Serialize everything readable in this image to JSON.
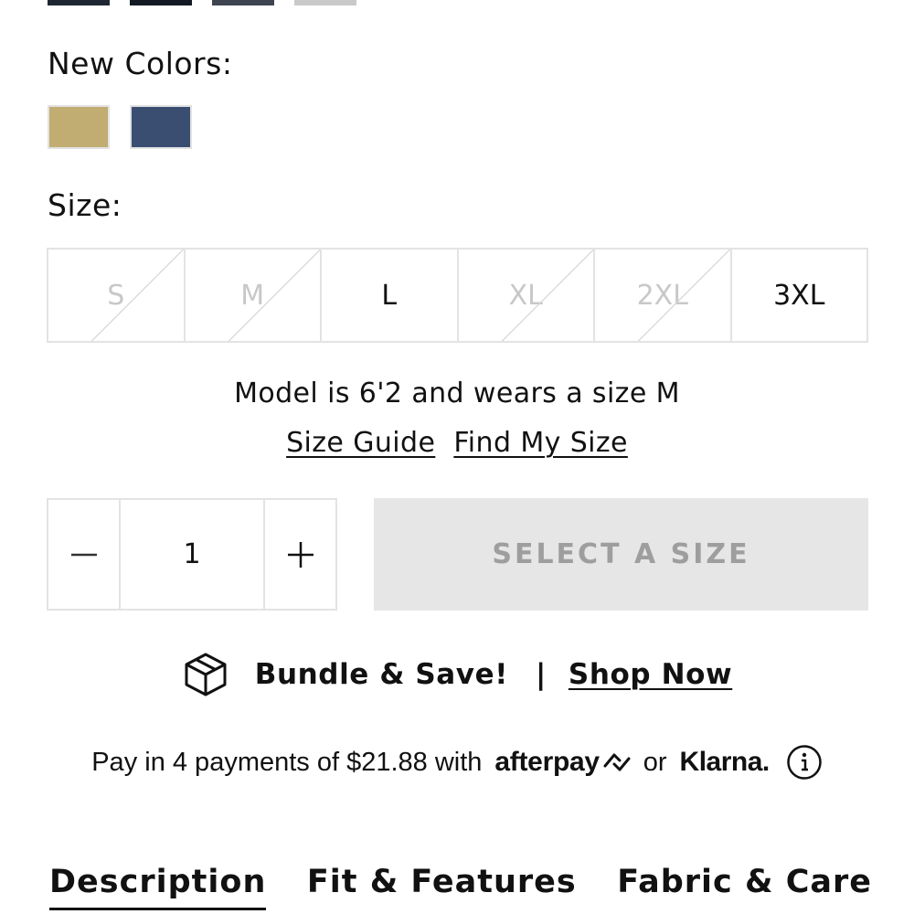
{
  "top_swatches": [
    {
      "name": "swatch-1",
      "color": "#1f2633"
    },
    {
      "name": "swatch-2",
      "color": "#141a24"
    },
    {
      "name": "swatch-3",
      "color": "#3e4450"
    },
    {
      "name": "swatch-4",
      "color": "#c9c9c9"
    }
  ],
  "new_colors": {
    "label": "New Colors:",
    "swatches": [
      {
        "color": "#c1ad72"
      },
      {
        "color": "#3a4e72"
      }
    ]
  },
  "size": {
    "label": "Size:",
    "options": [
      {
        "label": "S",
        "available": false
      },
      {
        "label": "M",
        "available": false
      },
      {
        "label": "L",
        "available": true
      },
      {
        "label": "XL",
        "available": false
      },
      {
        "label": "2XL",
        "available": false
      },
      {
        "label": "3XL",
        "available": true
      }
    ]
  },
  "model_note": "Model is 6'2 and wears a size M",
  "links": {
    "size_guide": "Size Guide",
    "find_my_size": "Find My Size"
  },
  "quantity": {
    "value": "1"
  },
  "add_button": {
    "label": "SELECT A SIZE"
  },
  "bundle": {
    "text": "Bundle & Save!",
    "separator": "|",
    "link": "Shop Now"
  },
  "payments": {
    "prefix": "Pay in 4 payments of $21.88 with",
    "afterpay": "afterpay",
    "or": "or",
    "klarna": "Klarna."
  },
  "tabs": [
    {
      "label": "Description",
      "active": true
    },
    {
      "label": "Fit & Features",
      "active": false
    },
    {
      "label": "Fabric & Care",
      "active": false
    }
  ],
  "colors": {
    "border": "#e3e3e3",
    "disabled_button_bg": "#e6e6e6",
    "disabled_button_text": "#9e9e9e",
    "unavailable_text": "#c8c8c8"
  }
}
